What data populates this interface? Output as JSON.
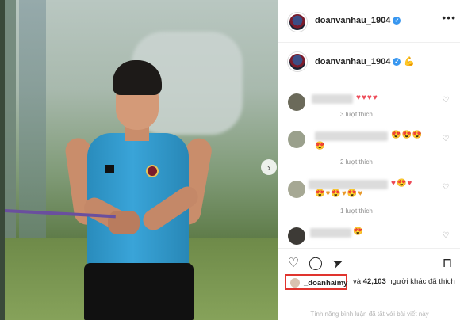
{
  "post": {
    "author": "doanvanhau_1904",
    "more_label": "•••",
    "next_arrow": "›",
    "caption_emoji": "💪"
  },
  "comments": [
    {
      "emojis": "♥♥♥♥",
      "likes": "3 lượt thích"
    },
    {
      "emojis_a": "😍😍😍",
      "emojis_b": "😍",
      "likes": "2 lượt thích"
    },
    {
      "emojis_a": "♥😍♥",
      "emojis_b": "😍♥😍♥😍♥",
      "likes": "1 lượt thích"
    },
    {
      "emojis": "😍"
    }
  ],
  "actions": {
    "like_icon": "♡",
    "comment_icon": "◯",
    "share_icon": "➤",
    "save_icon": "⊓"
  },
  "liked_by": {
    "user": "_doanhaimy",
    "rest_prefix": "và",
    "count": "42,103",
    "rest_suffix": "người khác đã thích"
  },
  "footer": {
    "note": "Tính năng bình luận đã tắt với bài viết này"
  },
  "icons": {
    "heart_outline": "♡",
    "verified": "✓"
  },
  "colors": {
    "jersey": "#2f9fd6",
    "verified": "#3897f0",
    "highlight_box": "#e0342e"
  }
}
